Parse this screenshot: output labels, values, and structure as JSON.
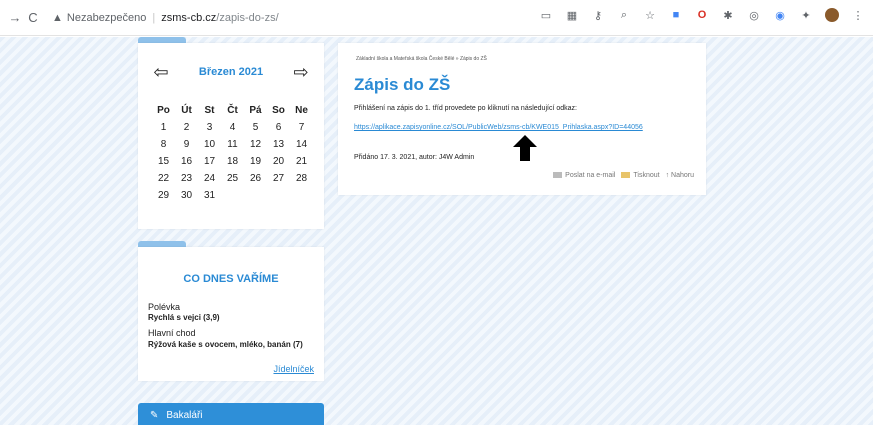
{
  "browser": {
    "security_label": "Nezabezpečeno",
    "url_host": "zsms-cb.cz",
    "url_path": "/zapis-do-zs/"
  },
  "calendar": {
    "month": "Březen 2021",
    "weekdays": [
      "Po",
      "Út",
      "St",
      "Čt",
      "Pá",
      "So",
      "Ne"
    ],
    "weeks": [
      [
        "1",
        "2",
        "3",
        "4",
        "5",
        "6",
        "7"
      ],
      [
        "8",
        "9",
        "10",
        "11",
        "12",
        "13",
        "14"
      ],
      [
        "15",
        "16",
        "17",
        "18",
        "19",
        "20",
        "21"
      ],
      [
        "22",
        "23",
        "24",
        "25",
        "26",
        "27",
        "28"
      ],
      [
        "29",
        "30",
        "31",
        "",
        "",
        "",
        ""
      ]
    ]
  },
  "menu": {
    "title": "CO DNES VAŘÍME",
    "soup_label": "Polévka",
    "soup": "Rychlá s vejci (3,9)",
    "main_label": "Hlavní chod",
    "main": "Rýžová kaše s ovocem, mléko, banán (7)",
    "link": "Jídelníček"
  },
  "bakalari": {
    "label": "Bakaláři"
  },
  "article": {
    "breadcrumb": "Základní škola a Mateřská škola České Bělé » Zápis do ZŠ",
    "title": "Zápis do ZŠ",
    "text": "Přihlášení na zápis do 1. tříd provedete po kliknutí na následující odkaz:",
    "link": "https://aplikace.zapisyonline.cz/SOL/PublicWeb/zsms-cb/KWE015_Prihlaska.aspx?ID=44056",
    "added": "Přidáno 17. 3. 2021, autor: J4W Admin",
    "email": "Poslat na e-mail",
    "print": "Tisknout",
    "top": "Nahoru"
  }
}
